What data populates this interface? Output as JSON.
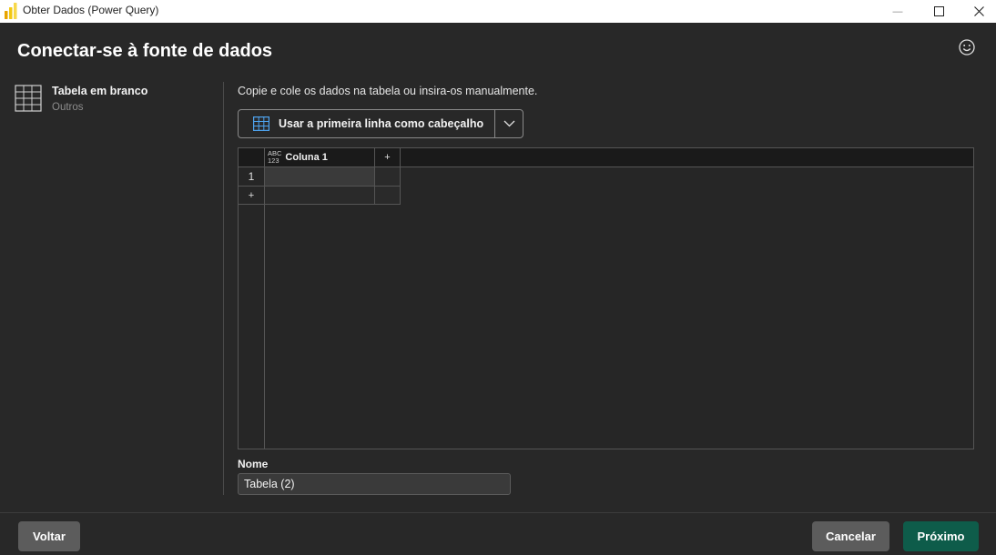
{
  "window": {
    "title": "Obter Dados (Power Query)",
    "minimize_glyph": "—",
    "maximize_glyph": "☐",
    "close_glyph": "✕"
  },
  "header": {
    "title": "Conectar-se à fonte de dados",
    "feedback_icon": "smiley-icon"
  },
  "source": {
    "name": "Tabela em branco",
    "category": "Outros",
    "icon": "table-grid-icon"
  },
  "main": {
    "instruction": "Copie e cole os dados na tabela ou insira-os manualmente.",
    "header_toggle_label": "Usar a primeira linha como cabeçalho",
    "grid": {
      "type_icon_top": "ABC",
      "type_icon_bottom": "123",
      "column_name": "Coluna 1",
      "add_column": "+",
      "rows": [
        "1"
      ],
      "add_row": "+"
    },
    "name_label": "Nome",
    "name_value": "Tabela (2)"
  },
  "footer": {
    "back": "Voltar",
    "cancel": "Cancelar",
    "next": "Próximo"
  },
  "colors": {
    "background": "#282828",
    "accent_next": "#0e5c4a",
    "secondary_button": "#5c5c5c",
    "powerbi_yellow": "#f2c811"
  }
}
